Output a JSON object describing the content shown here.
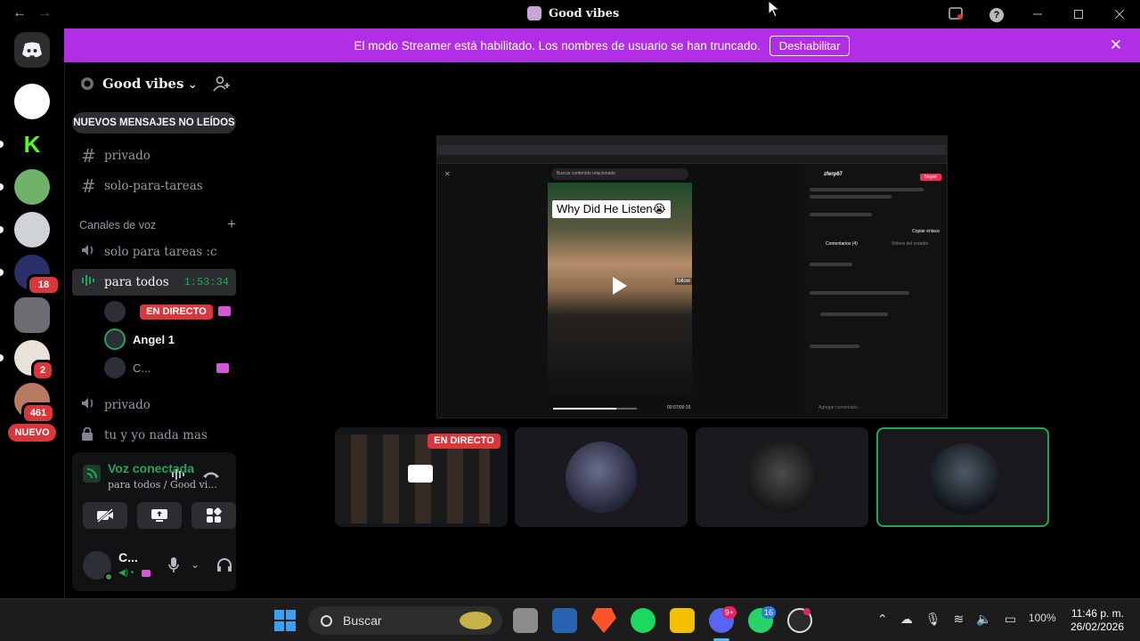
{
  "window": {
    "title": "Good vibes",
    "back_icon": "←",
    "forward_icon": "→",
    "help_icon": "?"
  },
  "notice": {
    "text": "El modo Streamer está habilitado. Los nombres de usuario se han truncado.",
    "button": "Deshabilitar",
    "close": "✕"
  },
  "rail": {
    "badges": [
      "18",
      "2",
      "461"
    ],
    "new_label": "NUEVO"
  },
  "server": {
    "name": "Good vibes",
    "chevron": "⌄",
    "unread_pill": "NUEVOS MENSAJES NO LEÍDOS"
  },
  "channels": {
    "text": [
      {
        "name": "privado"
      },
      {
        "name": "solo-para-tareas"
      }
    ],
    "voice_category": "Canales de voz",
    "voice": [
      {
        "name": "solo para tareas :c"
      },
      {
        "name": "para todos",
        "time": "1:53:34"
      }
    ],
    "voice_users": [
      {
        "name": "",
        "live": "EN DIRECTO"
      },
      {
        "name": "Angel 1"
      },
      {
        "name": "C..."
      }
    ],
    "more": [
      {
        "name": "privado"
      },
      {
        "name": "tu y yo nada mas"
      }
    ]
  },
  "voice_panel": {
    "status": "Voz conectada",
    "sub": "para todos / Good vi..."
  },
  "user": {
    "name": "C..."
  },
  "stream": {
    "search_placeholder": "Buscar contenido relacionado",
    "caption": "Why Did He Listen😭",
    "follow": "follow",
    "video_time": "00:07/00:15",
    "tiktok_user": "zferp67",
    "tiktok_follow": "Seguir",
    "tiktok_copy": "Copiar enlace",
    "tab_comments": "Comentarios (4)",
    "tab_creator": "Videos del creador",
    "comment_placeholder": "Agregar comentario..."
  },
  "tiles": {
    "live": "EN DIRECTO"
  },
  "taskbar": {
    "search": "Buscar",
    "discord_badge": "9+",
    "whatsapp_badge": "16",
    "battery": "100%",
    "time": "11:46 p. m.",
    "date": "26/02/2026"
  },
  "colors": {
    "notice": "#b22ee6",
    "live": "#da373c",
    "voice_green": "#23a559"
  }
}
